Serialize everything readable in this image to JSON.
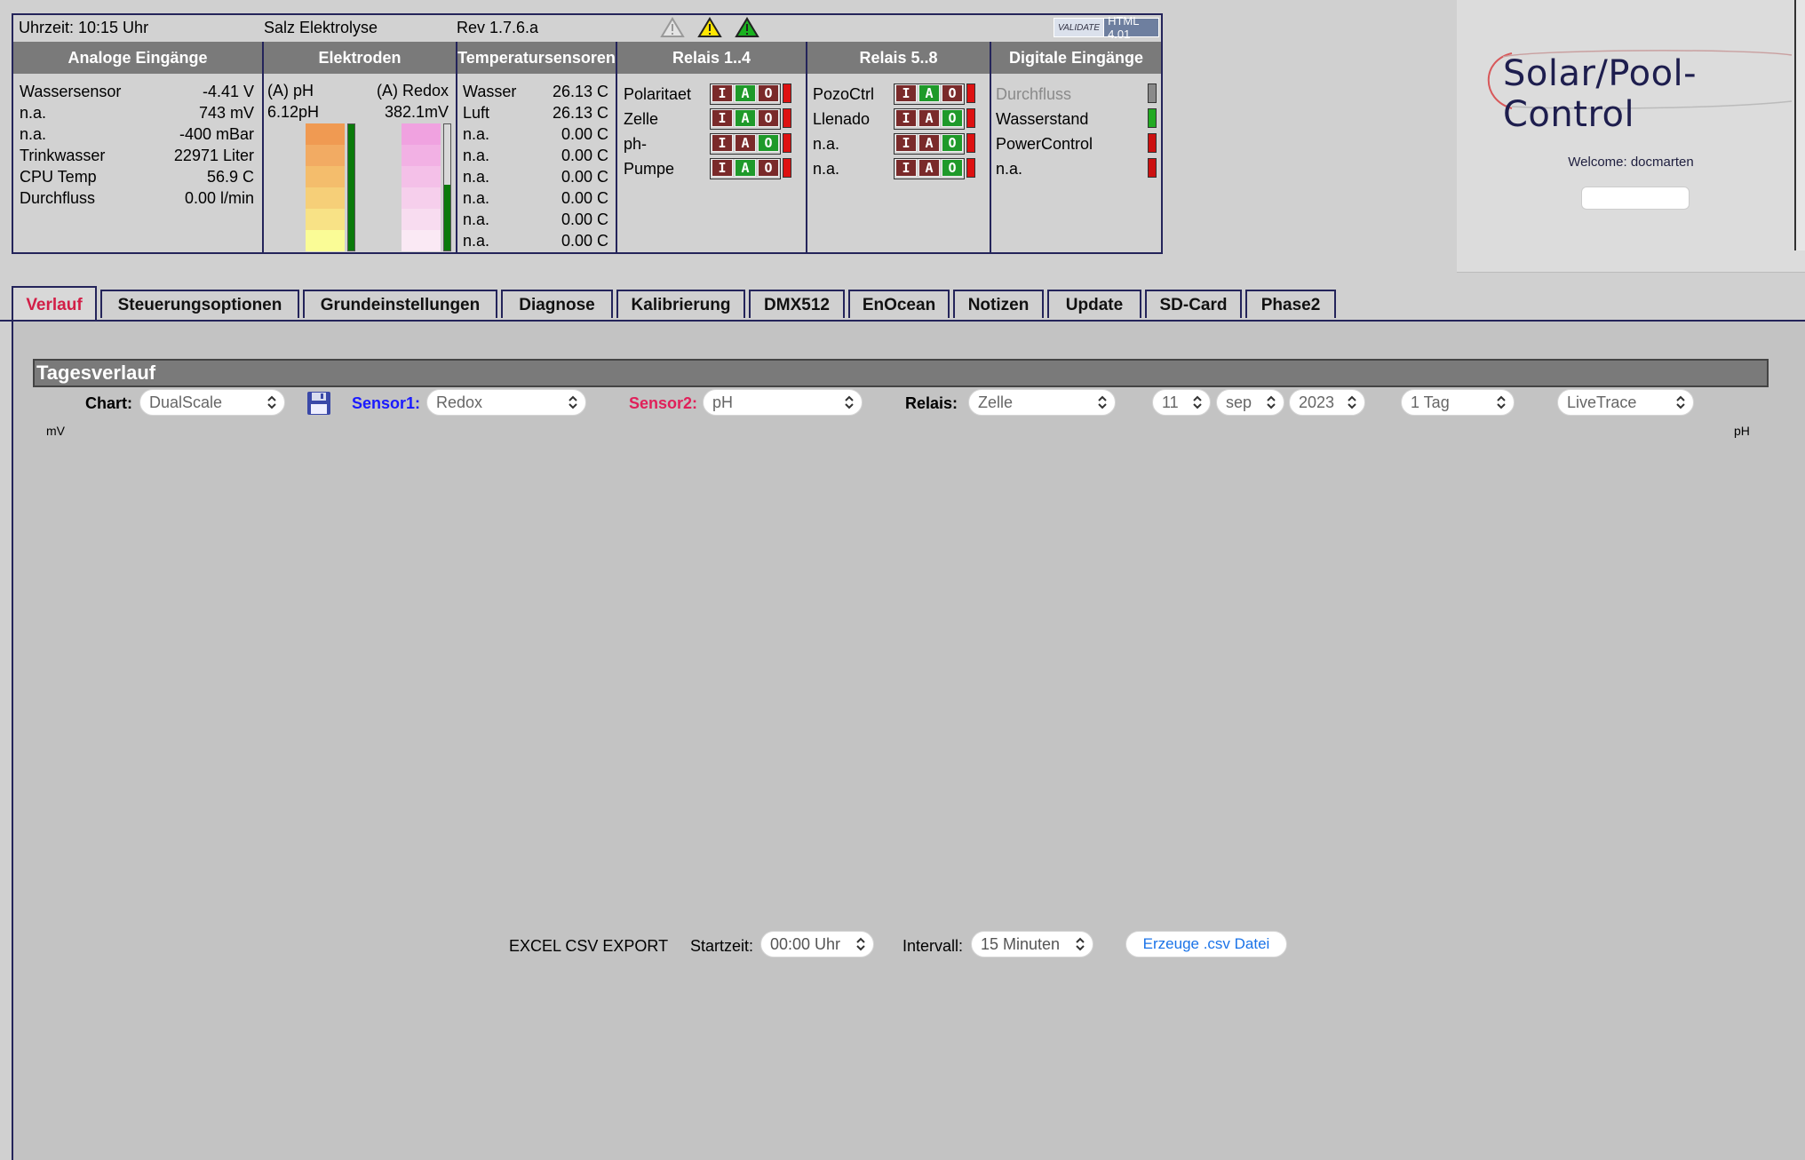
{
  "top": {
    "time": "Uhrzeit: 10:15 Uhr",
    "mode": "Salz Elektrolyse",
    "rev": "Rev 1.7.6.a",
    "validator_v": "VALIDATE",
    "validator_html": "HTML 4.01"
  },
  "sections": {
    "analog": "Analoge Eingänge",
    "electrodes": "Elektroden",
    "temps": "Temperatursensoren",
    "relais1": "Relais 1..4",
    "relais2": "Relais 5..8",
    "digital": "Digitale Eingänge"
  },
  "analog": [
    {
      "label": "Wassersensor",
      "value": "-4.41 V"
    },
    {
      "label": "n.a.",
      "value": "743 mV"
    },
    {
      "label": "n.a.",
      "value": "-400 mBar"
    },
    {
      "label": "Trinkwasser",
      "value": "22971 Liter"
    },
    {
      "label": "CPU Temp",
      "value": "56.9 C"
    },
    {
      "label": "Durchfluss",
      "value": "0.00 l/min"
    }
  ],
  "electrodes": {
    "ph_label": "(A) pH",
    "redox_label": "(A) Redox",
    "ph_value": "6.12pH",
    "redox_value": "382.1mV",
    "ph_colors": [
      "#f09a52",
      "#f2ab63",
      "#f4bd6c",
      "#f6cf78",
      "#f8e286",
      "#fafc96"
    ],
    "redox_colors": [
      "#f0a2e0",
      "#f2b1e4",
      "#f4c0e8",
      "#f6cfec",
      "#f8dcf0",
      "#fae9f4"
    ],
    "ph_level": 1.0,
    "redox_level": 0.52,
    "bar_color": "#0a7a0a"
  },
  "temps": [
    {
      "label": "Wasser",
      "value": "26.13 C"
    },
    {
      "label": "Luft",
      "value": "26.13 C"
    },
    {
      "label": "n.a.",
      "value": "0.00 C"
    },
    {
      "label": "n.a.",
      "value": "0.00 C"
    },
    {
      "label": "n.a.",
      "value": "0.00 C"
    },
    {
      "label": "n.a.",
      "value": "0.00 C"
    },
    {
      "label": "n.a.",
      "value": "0.00 C"
    },
    {
      "label": "n.a.",
      "value": "0.00 C"
    }
  ],
  "relais1": [
    {
      "label": "Polaritaet",
      "mode": "A"
    },
    {
      "label": "Zelle",
      "mode": "A"
    },
    {
      "label": "ph-",
      "mode": "O"
    },
    {
      "label": "Pumpe",
      "mode": "A"
    }
  ],
  "relais2": [
    {
      "label": "PozoCtrl",
      "mode": "A"
    },
    {
      "label": "Llenado",
      "mode": "O"
    },
    {
      "label": "n.a.",
      "mode": "O"
    },
    {
      "label": "n.a.",
      "mode": "O"
    }
  ],
  "iao_letters": [
    "I",
    "A",
    "O"
  ],
  "digital": [
    {
      "label": "Durchfluss",
      "color": "#8a8a8a",
      "dim": true
    },
    {
      "label": "Wasserstand",
      "color": "#22aa22",
      "dim": false
    },
    {
      "label": "PowerControl",
      "color": "#cc1111",
      "dim": false
    },
    {
      "label": "n.a.",
      "color": "#cc1111",
      "dim": false
    }
  ],
  "logo": {
    "text": "Solar/Pool-Control",
    "welcome": "Welcome:  docmarten"
  },
  "tabs": [
    "Verlauf",
    "Steuerungsoptionen",
    "Grundeinstellungen",
    "Diagnose",
    "Kalibrierung",
    "DMX512",
    "EnOcean",
    "Notizen",
    "Update",
    "SD-Card",
    "Phase2"
  ],
  "content": {
    "title": "Tagesverlauf",
    "chart_label": "Chart:",
    "chart_value": "DualScale",
    "sensor1_label": "Sensor1:",
    "sensor1_value": "Redox",
    "sensor2_label": "Sensor2:",
    "sensor2_value": "pH",
    "relais_label": "Relais:",
    "relais_value": "Zelle",
    "day": "11",
    "month": "sep",
    "year": "2023",
    "range": "1 Tag",
    "trace": "LiveTrace",
    "y_left": "mV",
    "y_right": "pH",
    "sensor1_color": "#1a1aff",
    "sensor2_color": "#e0205a",
    "export_label": "EXCEL CSV EXPORT",
    "start_label": "Startzeit:",
    "start_value": "00:00 Uhr",
    "interval_label": "Intervall:",
    "interval_value": "15 Minuten",
    "export_button": "Erzeuge .csv Datei"
  }
}
